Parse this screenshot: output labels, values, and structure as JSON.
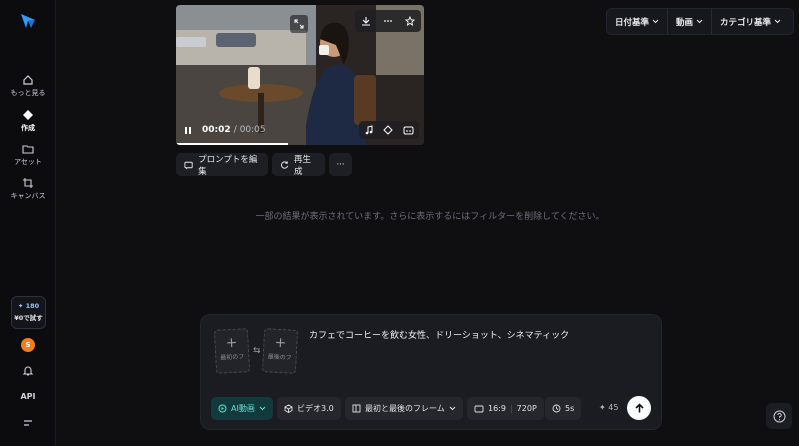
{
  "sidebar": {
    "items": [
      {
        "label": "もっと見る",
        "icon": "home-icon"
      },
      {
        "label": "作成",
        "icon": "create-diamond-icon"
      },
      {
        "label": "アセット",
        "icon": "folder-icon"
      },
      {
        "label": "キャンバス",
        "icon": "canvas-crop-icon"
      }
    ],
    "trial": {
      "credits": "✦ 180",
      "cta": "¥0で試す"
    },
    "avatar_initial": "S",
    "api_label": "API"
  },
  "video": {
    "current_time": "00:02",
    "total_time": "/ 00:05",
    "progress": 0.4
  },
  "actions": {
    "edit_prompt": "プロンプトを編集",
    "regenerate": "再生成",
    "more": "···"
  },
  "filters": [
    {
      "label": "日付基準"
    },
    {
      "label": "動画"
    },
    {
      "label": "カテゴリ基準"
    }
  ],
  "notice": "一部の結果が表示されています。さらに表示するにはフィルターを削除してください。",
  "composer": {
    "first_frame_label": "最初のフ",
    "last_frame_label": "最後のフ",
    "prompt": "カフェでコーヒーを飲む女性、ドリーショット、シネマティック",
    "mode": "AI動画",
    "model": "ビデオ3.0",
    "frames_mode": "最初と最後のフレーム",
    "ratio": "16:9",
    "resolution": "720P",
    "duration": "5s",
    "cost": "✦ 45"
  },
  "colors": {
    "accent": "#5de0d4",
    "avatar": "#f27d1c",
    "background": "#0f0f12"
  }
}
